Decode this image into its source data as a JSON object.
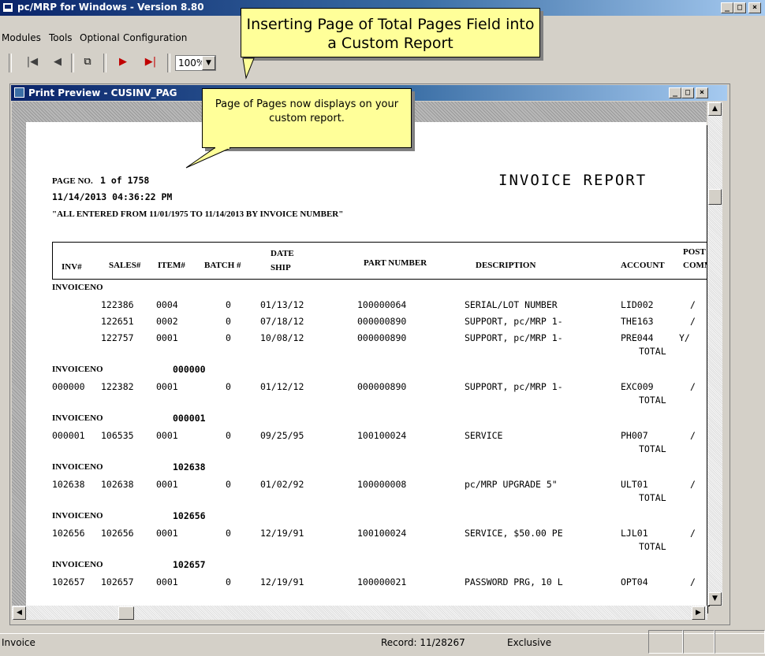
{
  "app": {
    "title": "pc/MRP for Windows - Version 8.80",
    "min": "_",
    "max": "□",
    "close": "×"
  },
  "menu": {
    "items": [
      "Modules",
      "Tools",
      "Optional",
      "Configuration"
    ]
  },
  "toolbar": {
    "first": "|◀",
    "prev": "◀",
    "copy": "⧉",
    "next": "▶",
    "last": "▶|",
    "zoom": "100%",
    "zoom_arrow": "▼"
  },
  "callouts": {
    "main": "Inserting Page of Total Pages Field into a Custom Report",
    "note": "Page of Pages now displays on your custom report."
  },
  "preview": {
    "title": "Print Preview - CUSINV_PAG",
    "min": "_",
    "max": "□",
    "close": "×"
  },
  "report": {
    "page_label": "PAGE NO.",
    "page_value": "1 of 1758",
    "datetime": "11/14/2013 04:36:22 PM",
    "filter": "\"ALL    ENTERED FROM 11/01/1975 TO 11/14/2013 BY INVOICE NUMBER\"",
    "title": "INVOICE REPORT",
    "headers": {
      "inv": "INV#",
      "sales": "SALES#",
      "item": "ITEM#",
      "batch": "BATCH #",
      "date1": "DATE",
      "date2": "SHIP",
      "part": "PART NUMBER",
      "desc": "DESCRIPTION",
      "account": "ACCOUNT",
      "post1": "POST",
      "post2": "COMM"
    },
    "group_label": "INVOICENO",
    "total_label": "TOTAL",
    "groups": [
      {
        "invno": "",
        "rows": [
          {
            "inv": "",
            "sales": "122386",
            "item": "0004",
            "batch": "0",
            "date": "01/13/12",
            "part": "100000064",
            "desc": "SERIAL/LOT NUMBER",
            "account": "LID002",
            "post": "/"
          },
          {
            "inv": "",
            "sales": "122651",
            "item": "0002",
            "batch": "0",
            "date": "07/18/12",
            "part": "000000890",
            "desc": "SUPPORT, pc/MRP 1-",
            "account": "THE163",
            "post": "/"
          },
          {
            "inv": "",
            "sales": "122757",
            "item": "0001",
            "batch": "0",
            "date": "10/08/12",
            "part": "000000890",
            "desc": "SUPPORT, pc/MRP 1-",
            "account": "PRE044",
            "post": "Y/"
          }
        ]
      },
      {
        "invno": "000000",
        "rows": [
          {
            "inv": "000000",
            "sales": "122382",
            "item": "0001",
            "batch": "0",
            "date": "01/12/12",
            "part": "000000890",
            "desc": "SUPPORT, pc/MRP 1-",
            "account": "EXC009",
            "post": "/"
          }
        ]
      },
      {
        "invno": "000001",
        "rows": [
          {
            "inv": "000001",
            "sales": "106535",
            "item": "0001",
            "batch": "0",
            "date": "09/25/95",
            "part": "100100024",
            "desc": "SERVICE",
            "account": "PH007",
            "post": "/"
          }
        ]
      },
      {
        "invno": "102638",
        "rows": [
          {
            "inv": "102638",
            "sales": "102638",
            "item": "0001",
            "batch": "0",
            "date": "01/02/92",
            "part": "100000008",
            "desc": "pc/MRP UPGRADE 5\"",
            "account": "ULT01",
            "post": "/"
          }
        ]
      },
      {
        "invno": "102656",
        "rows": [
          {
            "inv": "102656",
            "sales": "102656",
            "item": "0001",
            "batch": "0",
            "date": "12/19/91",
            "part": "100100024",
            "desc": "SERVICE, $50.00 PE",
            "account": "LJL01",
            "post": "/"
          }
        ]
      },
      {
        "invno": "102657",
        "rows": [
          {
            "inv": "102657",
            "sales": "102657",
            "item": "0001",
            "batch": "0",
            "date": "12/19/91",
            "part": "100000021",
            "desc": "PASSWORD PRG, 10 L",
            "account": "OPT04",
            "post": "/"
          }
        ]
      }
    ]
  },
  "status": {
    "left": "Invoice",
    "record": "Record: 11/28267",
    "mode": "Exclusive"
  },
  "colors": {
    "titlebar": "#0a246a",
    "callout": "#ffff99",
    "chrome": "#d4d0c8"
  }
}
